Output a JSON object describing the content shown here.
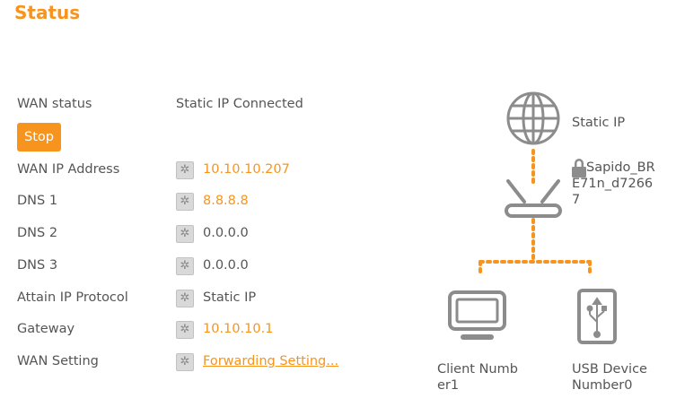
{
  "page": {
    "title": "Status"
  },
  "wan": {
    "status_label": "WAN status",
    "status_value": "Static IP Connected",
    "stop_button": "Stop",
    "rows": [
      {
        "label": "WAN IP Address",
        "value": "10.10.10.207"
      },
      {
        "label": "DNS 1",
        "value": "8.8.8.8"
      },
      {
        "label": "DNS 2",
        "value": "0.0.0.0"
      },
      {
        "label": "DNS 3",
        "value": "0.0.0.0"
      },
      {
        "label": "Attain IP Protocol",
        "value": "Static IP"
      },
      {
        "label": "Gateway",
        "value": "10.10.10.1"
      },
      {
        "label": "WAN Setting",
        "value": "Forwarding Setting..."
      }
    ]
  },
  "diagram": {
    "internet_label": "Static IP",
    "router_name_line1": "Sapido_BR",
    "router_name_line2": "E71n_d7266",
    "router_name_line3": "7",
    "client_label_line1": "Client Numb",
    "client_label_line2": "er1",
    "usb_label_line1": "USB Device",
    "usb_label_line2": "Number0"
  },
  "colors": {
    "accent": "#f7941d",
    "text": "#555555",
    "icon": "#8c8c8c"
  }
}
